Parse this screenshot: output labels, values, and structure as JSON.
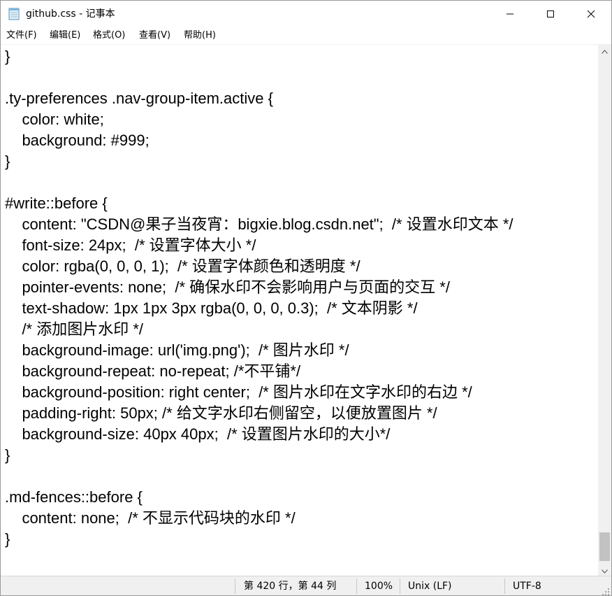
{
  "window": {
    "title": "github.css - 记事本"
  },
  "menu": {
    "items": [
      {
        "label": "文件(F)"
      },
      {
        "label": "编辑(E)"
      },
      {
        "label": "格式(O)"
      },
      {
        "label": "查看(V)"
      },
      {
        "label": "帮助(H)"
      }
    ]
  },
  "editor": {
    "lines": [
      "}",
      "",
      ".ty-preferences .nav-group-item.active {",
      "    color: white;",
      "    background: #999;",
      "}",
      "",
      "#write::before {",
      "    content: \"CSDN@果子当夜宵：bigxie.blog.csdn.net\";  /* 设置水印文本 */",
      "    font-size: 24px;  /* 设置字体大小 */",
      "    color: rgba(0, 0, 0, 1);  /* 设置字体颜色和透明度 */",
      "    pointer-events: none;  /* 确保水印不会影响用户与页面的交互 */",
      "    text-shadow: 1px 1px 3px rgba(0, 0, 0, 0.3);  /* 文本阴影 */",
      "    /* 添加图片水印 */",
      "    background-image: url('img.png');  /* 图片水印 */",
      "    background-repeat: no-repeat; /*不平铺*/",
      "    background-position: right center;  /* 图片水印在文字水印的右边 */",
      "    padding-right: 50px; /* 给文字水印右侧留空，以便放置图片 */",
      "    background-size: 40px 40px;  /* 设置图片水印的大小*/",
      "}",
      "",
      ".md-fences::before {",
      "    content: none;  /* 不显示代码块的水印 */",
      "}"
    ]
  },
  "statusbar": {
    "position": "第 420 行，第 44 列",
    "zoom": "100%",
    "line_ending": "Unix (LF)",
    "encoding": "UTF-8"
  },
  "icons": {
    "app": "notepad-icon",
    "minimize": "minimize-icon",
    "maximize": "maximize-icon",
    "close": "close-icon",
    "scroll_up": "chevron-up-icon",
    "scroll_down": "chevron-down-icon"
  },
  "colors": {
    "chrome": "#f0f0f0",
    "text": "#000000",
    "scroll_thumb": "#c2c2c2"
  }
}
